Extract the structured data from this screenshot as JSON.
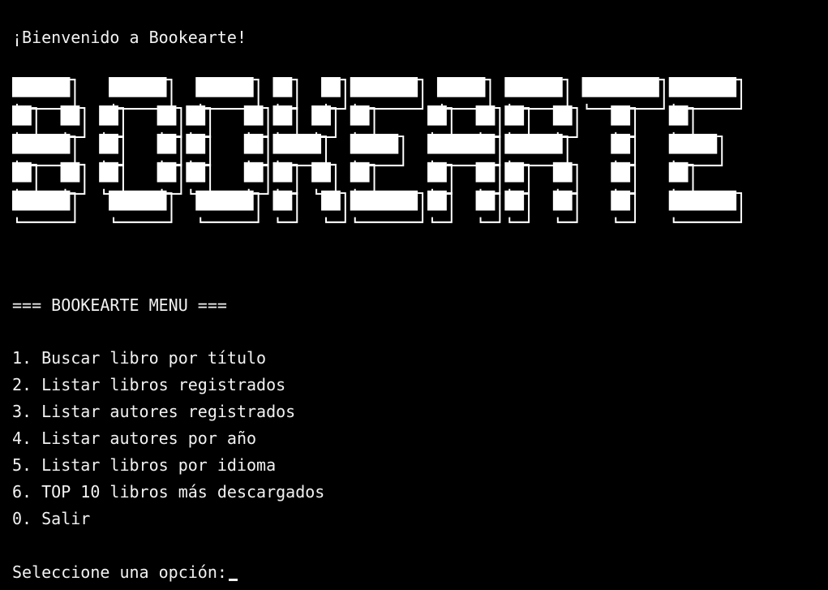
{
  "colors": {
    "background": "#000000",
    "foreground": "#f2f2f2",
    "banner_block": "#ffffff",
    "banner_shadow": "#ffffff"
  },
  "welcome": "¡Bienvenido a Bookearte!",
  "banner": {
    "text": "BOOKEARTE",
    "style": "ANSI Shadow block letters"
  },
  "menu": {
    "heading": "=== BOOKEARTE MENU ===",
    "options": [
      "1. Buscar libro por título",
      "2. Listar libros registrados",
      "3. Listar autores registrados",
      "4. Listar autores por año",
      "5. Listar libros por idioma",
      "6. TOP 10 libros más descargados",
      "0. Salir"
    ]
  },
  "prompt": "Seleccione una opción:"
}
